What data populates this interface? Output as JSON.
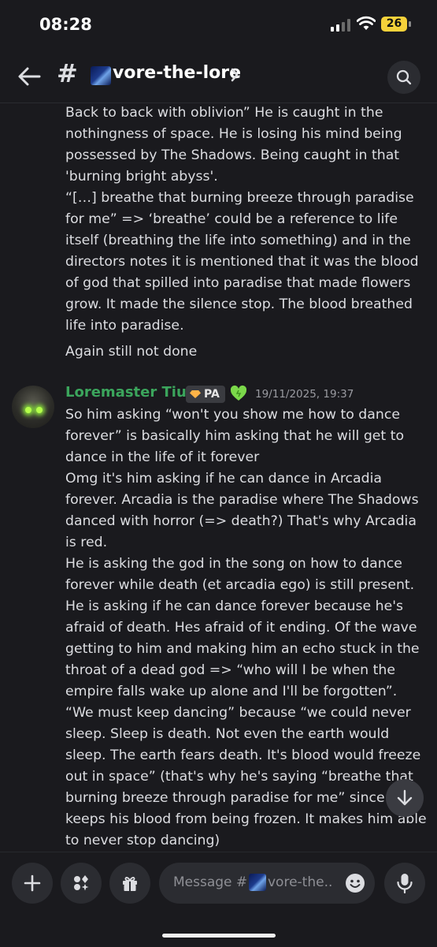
{
  "status_bar": {
    "time": "08:28",
    "battery": "26"
  },
  "header": {
    "channel_name": "vore-the-lore"
  },
  "messages": {
    "prev_paragraphs": [
      "Back to back with oblivion” He is caught in the nothingness of space. He is losing his mind being possessed by The Shadows. Being caught in that 'burning bright abyss'.\n“[…] breathe that burning breeze through paradise for me” => ‘breathe’ could be a reference to life itself (breathing the life into something) and in the directors notes it is mentioned that it was the blood of god that spilled into paradise that made flowers grow. It made the silence stop. The blood breathed life into paradise.",
      "Again still not done"
    ],
    "current": {
      "author": "Loremaster Tiup",
      "badge": "PA",
      "timestamp": "19/11/2025, 19:37",
      "body": "So him asking “won't you show me how to dance forever” is basically him asking that he will get to dance in the life of it forever\nOmg it's him asking if he can dance in Arcadia forever. Arcadia is the paradise where The Shadows danced with horror (=> death?) That's why Arcadia is red.\nHe is asking the god in the song on how to dance forever while death (et arcadia ego)  is still present. He is asking if he can dance forever because he's afraid of death. Hes afraid of it ending. Of the wave getting to him and making him an echo stuck in the throat of a dead god => “who will I be when the empire falls wake up alone and I'll be forgotten”.\n“We must keep dancing” because “we could never sleep. Sleep is death. Not even the earth would sleep. The earth fears death. It's blood would freeze out in space” (that's why he's saying “breathe that burning breeze through paradise for me” since that keeps his blood from being frozen. It makes him able to never stop dancing)"
    }
  },
  "composer": {
    "placeholder_prefix": "Message #",
    "placeholder_channel": "vore-the.."
  },
  "icons": {
    "back": "arrow-left-icon",
    "hash": "hash-icon",
    "chevron": "chevron-right-icon",
    "search": "search-icon",
    "plus": "plus-icon",
    "apps": "apps-icon",
    "gift": "gift-icon",
    "emoji": "emoji-icon",
    "mic": "microphone-icon",
    "scroll": "arrow-down-icon",
    "heart": "green-heart-icon"
  },
  "colors": {
    "background": "#1a1a1e",
    "author": "#3ba55c",
    "text": "#dcdde1",
    "muted": "#8e8f95"
  }
}
